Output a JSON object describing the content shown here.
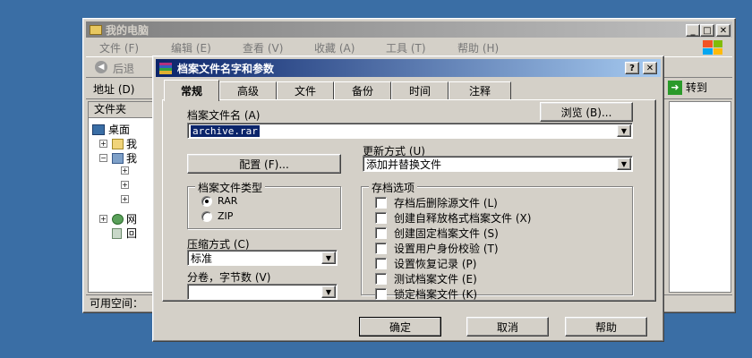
{
  "explorer": {
    "title": "我的电脑",
    "menu": [
      "文件 (F)",
      "编辑 (E)",
      "查看 (V)",
      "收藏 (A)",
      "工具 (T)",
      "帮助 (H)"
    ],
    "back_label": "后退",
    "address_label": "地址 (D)",
    "go_label": "转到",
    "folders_label": "文件夹",
    "tree": [
      "桌面",
      "我",
      "我",
      "网",
      "回"
    ],
    "status": "可用空间："
  },
  "dialog": {
    "title": "档案文件名字和参数",
    "tabs": [
      "常规",
      "高级",
      "文件",
      "备份",
      "时间",
      "注释"
    ],
    "archive_name_label": "档案文件名 (A)",
    "browse_label": "浏览 (B)...",
    "archive_name_value": "archive.rar",
    "config_label": "配置 (F)...",
    "update_method_label": "更新方式 (U)",
    "update_method_value": "添加并替换文件",
    "archive_type_label": "档案文件类型",
    "type_rar": "RAR",
    "type_zip": "ZIP",
    "compression_label": "压缩方式 (C)",
    "compression_value": "标准",
    "volume_label": "分卷，字节数 (V)",
    "volume_value": "",
    "options_label": "存档选项",
    "options": [
      "存档后删除源文件 (L)",
      "创建自释放格式档案文件 (X)",
      "创建固定档案文件 (S)",
      "设置用户身份校验 (T)",
      "设置恢复记录 (P)",
      "测试档案文件 (E)",
      "锁定档案文件 (K)"
    ],
    "ok_label": "确定",
    "cancel_label": "取消",
    "help_label": "帮助"
  }
}
